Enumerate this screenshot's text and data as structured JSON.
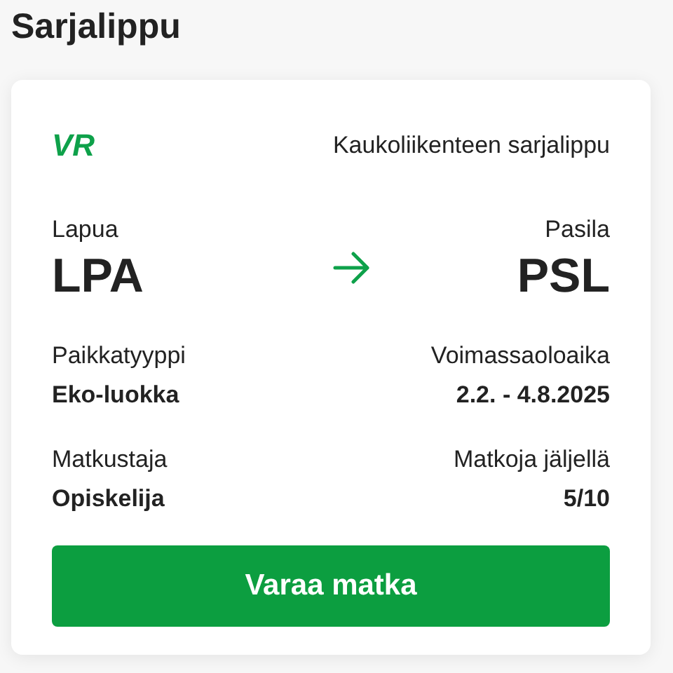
{
  "title": "Sarjalippu",
  "card": {
    "logo": "VR",
    "ticket_type": "Kaukoliikenteen sarjalippu",
    "from": {
      "name": "Lapua",
      "code": "LPA"
    },
    "to": {
      "name": "Pasila",
      "code": "PSL"
    },
    "details": [
      {
        "left": {
          "label": "Paikkatyyppi",
          "value": "Eko-luokka"
        },
        "right": {
          "label": "Voimassaoloaika",
          "value": "2.2. - 4.8.2025"
        }
      },
      {
        "left": {
          "label": "Matkustaja",
          "value": "Opiskelija"
        },
        "right": {
          "label": "Matkoja jäljellä",
          "value": "5/10"
        }
      }
    ],
    "button": "Varaa matka"
  }
}
